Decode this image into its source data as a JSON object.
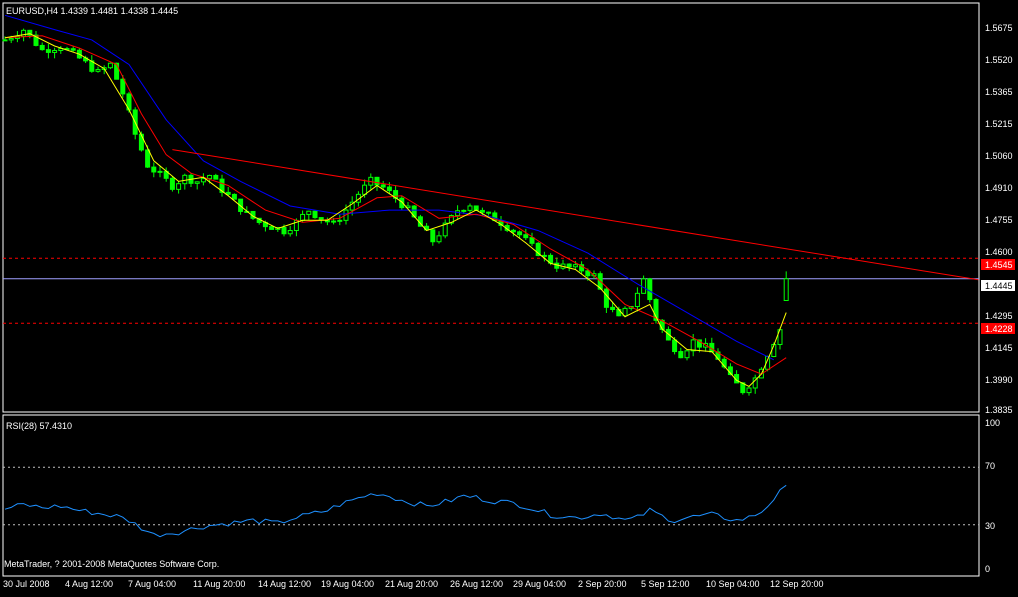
{
  "main_panel": {
    "title": "EURUSD,H4  1.4339 1.4481 1.4338 1.4445",
    "price_labels": [
      "1.5675",
      "1.5520",
      "1.5365",
      "1.5215",
      "1.5060",
      "1.4910",
      "1.4755",
      "1.4600",
      "1.4445",
      "1.4295",
      "1.4145",
      "1.3990",
      "1.3835"
    ],
    "current_price_label": "1.4445",
    "level_labels": [
      "1.4545",
      "1.4228"
    ]
  },
  "rsi_panel": {
    "title": "RSI(28) 57.4310",
    "scale_labels": [
      "100",
      "70",
      "30",
      "0"
    ]
  },
  "time_labels": [
    "30 Jul 2008",
    "4 Aug 12:00",
    "7 Aug 04:00",
    "11 Aug 20:00",
    "14 Aug 12:00",
    "19 Aug 04:00",
    "21 Aug 20:00",
    "26 Aug 12:00",
    "29 Aug 04:00",
    "2 Sep 20:00",
    "5 Sep 12:00",
    "10 Sep 04:00",
    "12 Sep 20:00"
  ],
  "footer": "MetaTrader, ? 2001-2008 MetaQuotes Software Corp.",
  "colors": {
    "background": "#000000",
    "candle": "#00ff00",
    "ma_fast": "#ffff00",
    "ma_mid": "#ff0000",
    "ma_slow": "#0000ff",
    "trendline": "#ff0000",
    "level_line": "#ff0000",
    "current_price_line": "#a0a0ff",
    "level_badge": "#ff0000",
    "rsi_line": "#1e90ff",
    "grid_dotted": "#c0c0c0"
  },
  "chart_data": [
    {
      "type": "line",
      "name_hint": "price-panel",
      "symbol": "EURUSD",
      "timeframe": "H4",
      "ohlc_last": {
        "open": 1.4339,
        "high": 1.4481,
        "low": 1.4338,
        "close": 1.4445
      },
      "ylim": [
        1.3805,
        1.578
      ],
      "x": [
        "30 Jul 2008",
        "4 Aug 12:00",
        "7 Aug 04:00",
        "11 Aug 20:00",
        "14 Aug 12:00",
        "19 Aug 04:00",
        "21 Aug 20:00",
        "26 Aug 12:00",
        "29 Aug 04:00",
        "2 Sep 20:00",
        "5 Sep 12:00",
        "10 Sep 04:00",
        "12 Sep 20:00"
      ],
      "close_path": [
        [
          0,
          1.561
        ],
        [
          3,
          1.566
        ],
        [
          6,
          1.556
        ],
        [
          9,
          1.558
        ],
        [
          12,
          1.552
        ],
        [
          15,
          1.545
        ],
        [
          17,
          1.549
        ],
        [
          19,
          1.535
        ],
        [
          21,
          1.515
        ],
        [
          23,
          1.5
        ],
        [
          25,
          1.495
        ],
        [
          27,
          1.49
        ],
        [
          29,
          1.494
        ],
        [
          31,
          1.492
        ],
        [
          33,
          1.495
        ],
        [
          35,
          1.488
        ],
        [
          37,
          1.482
        ],
        [
          39,
          1.476
        ],
        [
          41,
          1.472
        ],
        [
          43,
          1.47
        ],
        [
          45,
          1.468
        ],
        [
          47,
          1.472
        ],
        [
          49,
          1.478
        ],
        [
          51,
          1.474
        ],
        [
          53,
          1.471
        ],
        [
          55,
          1.478
        ],
        [
          57,
          1.486
        ],
        [
          59,
          1.492
        ],
        [
          61,
          1.489
        ],
        [
          63,
          1.484
        ],
        [
          65,
          1.478
        ],
        [
          67,
          1.47
        ],
        [
          69,
          1.463
        ],
        [
          71,
          1.47
        ],
        [
          73,
          1.478
        ],
        [
          75,
          1.481
        ],
        [
          77,
          1.476
        ],
        [
          79,
          1.474
        ],
        [
          81,
          1.47
        ],
        [
          83,
          1.466
        ],
        [
          85,
          1.46
        ],
        [
          87,
          1.455
        ],
        [
          89,
          1.451
        ],
        [
          91,
          1.45
        ],
        [
          93,
          1.449
        ],
        [
          95,
          1.446
        ],
        [
          97,
          1.432
        ],
        [
          99,
          1.425
        ],
        [
          101,
          1.432
        ],
        [
          103,
          1.444
        ],
        [
          105,
          1.425
        ],
        [
          107,
          1.414
        ],
        [
          109,
          1.408
        ],
        [
          111,
          1.414
        ],
        [
          113,
          1.411
        ],
        [
          115,
          1.406
        ],
        [
          117,
          1.396
        ],
        [
          119,
          1.39
        ],
        [
          121,
          1.396
        ],
        [
          123,
          1.408
        ],
        [
          125,
          1.42
        ],
        [
          126,
          1.4445
        ]
      ],
      "ma_fast": [
        [
          0,
          1.562
        ],
        [
          4,
          1.564
        ],
        [
          8,
          1.558
        ],
        [
          12,
          1.554
        ],
        [
          16,
          1.547
        ],
        [
          20,
          1.527
        ],
        [
          24,
          1.502
        ],
        [
          28,
          1.492
        ],
        [
          32,
          1.494
        ],
        [
          36,
          1.485
        ],
        [
          40,
          1.475
        ],
        [
          44,
          1.469
        ],
        [
          48,
          1.473
        ],
        [
          52,
          1.473
        ],
        [
          56,
          1.481
        ],
        [
          60,
          1.49
        ],
        [
          64,
          1.482
        ],
        [
          68,
          1.468
        ],
        [
          72,
          1.472
        ],
        [
          76,
          1.478
        ],
        [
          80,
          1.471
        ],
        [
          84,
          1.462
        ],
        [
          88,
          1.452
        ],
        [
          92,
          1.449
        ],
        [
          96,
          1.44
        ],
        [
          100,
          1.426
        ],
        [
          104,
          1.432
        ],
        [
          106,
          1.42
        ],
        [
          110,
          1.41
        ],
        [
          114,
          1.409
        ],
        [
          118,
          1.395
        ],
        [
          120,
          1.392
        ],
        [
          122,
          1.398
        ],
        [
          124,
          1.412
        ],
        [
          126,
          1.428
        ]
      ],
      "ma_mid": [
        [
          0,
          1.562
        ],
        [
          6,
          1.563
        ],
        [
          12,
          1.557
        ],
        [
          18,
          1.549
        ],
        [
          22,
          1.525
        ],
        [
          26,
          1.505
        ],
        [
          30,
          1.496
        ],
        [
          36,
          1.49
        ],
        [
          42,
          1.478
        ],
        [
          48,
          1.472
        ],
        [
          54,
          1.474
        ],
        [
          60,
          1.484
        ],
        [
          64,
          1.485
        ],
        [
          70,
          1.474
        ],
        [
          76,
          1.476
        ],
        [
          82,
          1.471
        ],
        [
          88,
          1.459
        ],
        [
          94,
          1.449
        ],
        [
          100,
          1.432
        ],
        [
          106,
          1.424
        ],
        [
          112,
          1.414
        ],
        [
          118,
          1.403
        ],
        [
          122,
          1.398
        ],
        [
          126,
          1.406
        ]
      ],
      "ma_slow": [
        [
          0,
          1.573
        ],
        [
          8,
          1.566
        ],
        [
          14,
          1.561
        ],
        [
          20,
          1.549
        ],
        [
          26,
          1.522
        ],
        [
          32,
          1.502
        ],
        [
          38,
          1.492
        ],
        [
          46,
          1.48
        ],
        [
          54,
          1.476
        ],
        [
          62,
          1.478
        ],
        [
          70,
          1.478
        ],
        [
          78,
          1.475
        ],
        [
          86,
          1.468
        ],
        [
          94,
          1.457
        ],
        [
          102,
          1.442
        ],
        [
          110,
          1.428
        ],
        [
          118,
          1.414
        ],
        [
          124,
          1.405
        ]
      ],
      "trendline": [
        [
          27,
          1.5075
        ],
        [
          157,
          1.444
        ]
      ],
      "horizontal_levels": [
        1.4545,
        1.4228
      ],
      "current_price": 1.4445
    },
    {
      "type": "line",
      "name_hint": "rsi-panel",
      "indicator": "RSI(28)",
      "last_value": 57.431,
      "ylim": [
        0,
        100
      ],
      "levels": [
        70,
        30
      ],
      "x": [
        "30 Jul 2008",
        "4 Aug 12:00",
        "7 Aug 04:00",
        "11 Aug 20:00",
        "14 Aug 12:00",
        "19 Aug 04:00",
        "21 Aug 20:00",
        "26 Aug 12:00",
        "29 Aug 04:00",
        "2 Sep 20:00",
        "5 Sep 12:00",
        "10 Sep 04:00",
        "12 Sep 20:00"
      ],
      "values_path": [
        [
          0,
          41
        ],
        [
          3,
          44
        ],
        [
          6,
          42
        ],
        [
          9,
          43
        ],
        [
          12,
          40
        ],
        [
          15,
          38
        ],
        [
          18,
          36
        ],
        [
          20,
          33
        ],
        [
          22,
          28
        ],
        [
          24,
          23
        ],
        [
          26,
          24
        ],
        [
          28,
          25
        ],
        [
          30,
          27
        ],
        [
          32,
          29
        ],
        [
          34,
          30
        ],
        [
          36,
          31
        ],
        [
          38,
          32
        ],
        [
          40,
          33
        ],
        [
          42,
          32
        ],
        [
          44,
          31
        ],
        [
          46,
          34
        ],
        [
          48,
          36
        ],
        [
          50,
          38
        ],
        [
          52,
          40
        ],
        [
          54,
          44
        ],
        [
          56,
          47
        ],
        [
          58,
          50
        ],
        [
          60,
          52
        ],
        [
          62,
          50
        ],
        [
          64,
          47
        ],
        [
          66,
          45
        ],
        [
          68,
          43
        ],
        [
          70,
          45
        ],
        [
          72,
          47
        ],
        [
          74,
          50
        ],
        [
          76,
          49
        ],
        [
          78,
          47
        ],
        [
          80,
          46
        ],
        [
          82,
          45
        ],
        [
          84,
          43
        ],
        [
          86,
          40
        ],
        [
          88,
          37
        ],
        [
          90,
          36
        ],
        [
          92,
          35
        ],
        [
          94,
          36
        ],
        [
          96,
          38
        ],
        [
          98,
          36
        ],
        [
          100,
          33
        ],
        [
          102,
          35
        ],
        [
          104,
          40
        ],
        [
          106,
          36
        ],
        [
          108,
          33
        ],
        [
          110,
          35
        ],
        [
          112,
          36
        ],
        [
          114,
          37
        ],
        [
          116,
          35
        ],
        [
          118,
          33
        ],
        [
          120,
          35
        ],
        [
          122,
          39
        ],
        [
          124,
          48
        ],
        [
          126,
          57.431
        ]
      ]
    }
  ]
}
